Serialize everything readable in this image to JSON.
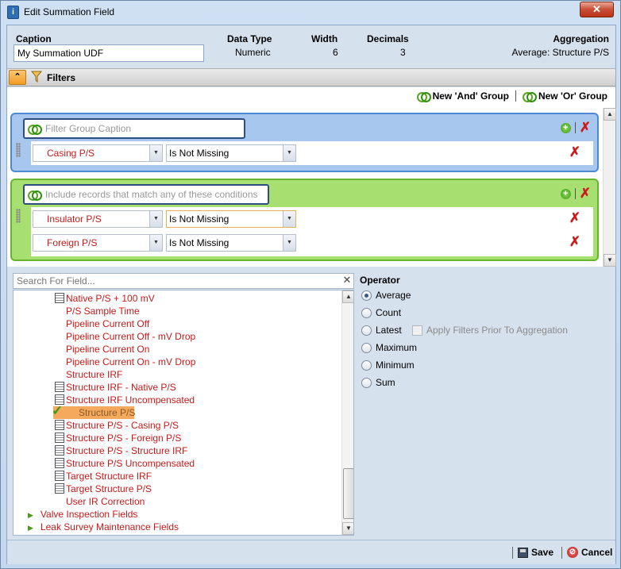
{
  "window": {
    "title": "Edit Summation Field",
    "close_label": "✕"
  },
  "header": {
    "caption_label": "Caption",
    "caption_value": "My Summation UDF",
    "data_type_label": "Data Type",
    "data_type_value": "Numeric",
    "width_label": "Width",
    "width_value": "6",
    "decimals_label": "Decimals",
    "decimals_value": "3",
    "aggregation_label": "Aggregation",
    "aggregation_value": "Average: Structure P/S"
  },
  "filters": {
    "title": "Filters",
    "new_and_group": "New 'And' Group",
    "new_or_group": "New 'Or' Group",
    "groups": [
      {
        "caption_placeholder": "Filter Group Caption",
        "color": "#a7c7ee",
        "rows": [
          {
            "field": "Casing P/S",
            "operator": "Is Not Missing"
          }
        ]
      },
      {
        "caption_placeholder": "Include records that match any of these conditions",
        "color": "#a7e070",
        "rows": [
          {
            "field": "Insulator P/S",
            "operator": "Is Not Missing"
          },
          {
            "field": "Foreign P/S",
            "operator": "Is Not Missing"
          }
        ]
      }
    ]
  },
  "search": {
    "placeholder": "Search For Field...",
    "clear": "✕"
  },
  "tree": {
    "items": [
      {
        "label": "Native P/S + 100 mV",
        "calc": true
      },
      {
        "label": "P/S Sample Time",
        "calc": false
      },
      {
        "label": "Pipeline Current Off",
        "calc": false
      },
      {
        "label": "Pipeline Current Off - mV Drop",
        "calc": false
      },
      {
        "label": "Pipeline Current On",
        "calc": false
      },
      {
        "label": "Pipeline Current On - mV Drop",
        "calc": false
      },
      {
        "label": "Structure IRF",
        "calc": false
      },
      {
        "label": "Structure IRF - Native P/S",
        "calc": true
      },
      {
        "label": "Structure IRF Uncompensated",
        "calc": true
      },
      {
        "label": "Structure P/S",
        "selected": true
      },
      {
        "label": "Structure P/S - Casing P/S",
        "calc": true
      },
      {
        "label": "Structure P/S - Foreign P/S",
        "calc": true
      },
      {
        "label": "Structure P/S - Structure IRF",
        "calc": true
      },
      {
        "label": "Structure P/S Uncompensated",
        "calc": true
      },
      {
        "label": "Target Structure IRF",
        "calc": true
      },
      {
        "label": "Target Structure P/S",
        "calc": true
      },
      {
        "label": "User IR Correction",
        "calc": false
      }
    ],
    "categories": [
      "Valve Inspection Fields",
      "Leak Survey Maintenance Fields"
    ]
  },
  "operator": {
    "title": "Operator",
    "options": [
      "Average",
      "Count",
      "Latest",
      "Maximum",
      "Minimum",
      "Sum"
    ],
    "selected": "Average",
    "apply_filters_label": "Apply Filters Prior To Aggregation"
  },
  "footer": {
    "save": "Save",
    "cancel": "Cancel"
  }
}
